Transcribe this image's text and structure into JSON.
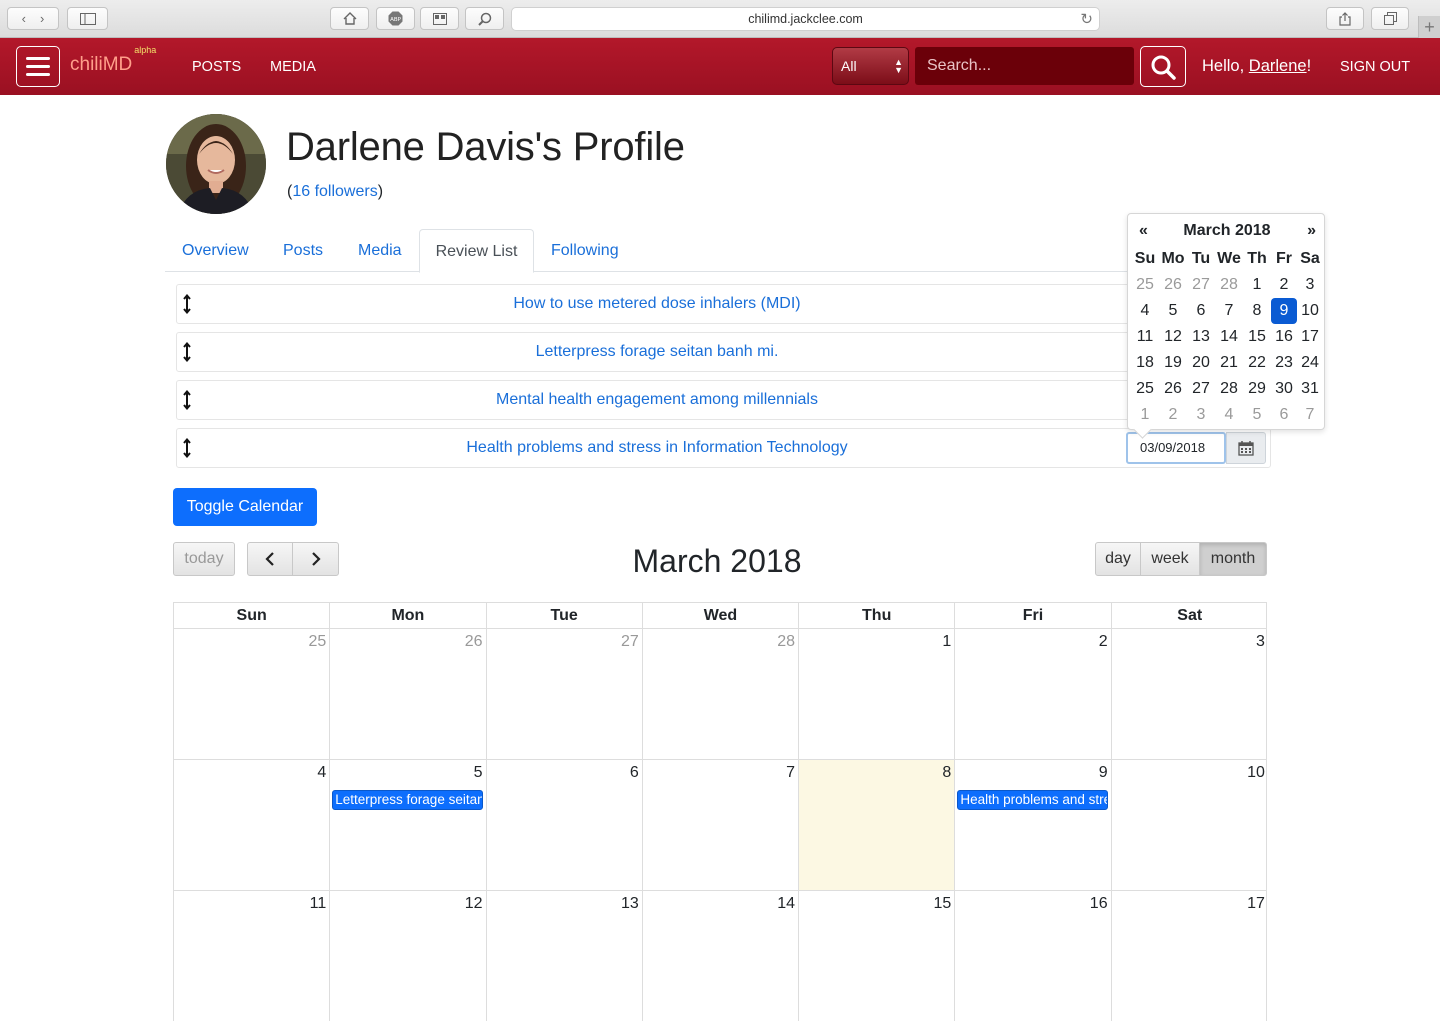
{
  "browser": {
    "url": "chilimd.jackclee.com"
  },
  "nav": {
    "brand": "chiliMD",
    "brand_tag": "alpha",
    "links": [
      "POSTS",
      "MEDIA"
    ],
    "filter_value": "All",
    "search_placeholder": "Search...",
    "hello_prefix": "Hello, ",
    "user_name": "Darlene",
    "hello_suffix": "!",
    "signout": "SIGN OUT",
    "brand_color": "#a8132a"
  },
  "profile": {
    "title": "Darlene Davis's Profile",
    "followers_open": "(",
    "followers_link": "16 followers",
    "followers_close": ")",
    "tabs": [
      "Overview",
      "Posts",
      "Media",
      "Review List",
      "Following"
    ],
    "active_tab": "Review List"
  },
  "review_list": [
    "How to use metered dose inhalers (MDI)",
    "Letterpress forage seitan banh mi.",
    "Mental health engagement among millennials",
    "Health problems and stress in Information Technology"
  ],
  "date_input": "03/09/2018",
  "datepicker": {
    "prev": "«",
    "next": "»",
    "month": "March 2018",
    "dow": [
      "Su",
      "Mo",
      "Tu",
      "We",
      "Th",
      "Fr",
      "Sa"
    ],
    "days": [
      [
        "25",
        "26",
        "27",
        "28",
        "1",
        "2",
        "3"
      ],
      [
        "4",
        "5",
        "6",
        "7",
        "8",
        "9",
        "10"
      ],
      [
        "11",
        "12",
        "13",
        "14",
        "15",
        "16",
        "17"
      ],
      [
        "18",
        "19",
        "20",
        "21",
        "22",
        "23",
        "24"
      ],
      [
        "25",
        "26",
        "27",
        "28",
        "29",
        "30",
        "31"
      ],
      [
        "1",
        "2",
        "3",
        "4",
        "5",
        "6",
        "7"
      ]
    ],
    "selected": "9"
  },
  "toggle_calendar": "Toggle Calendar",
  "calendar": {
    "today_btn": "today",
    "title": "March 2018",
    "views": [
      "day",
      "week",
      "month"
    ],
    "active_view": "month",
    "dow": [
      "Sun",
      "Mon",
      "Tue",
      "Wed",
      "Thu",
      "Fri",
      "Sat"
    ],
    "weeks": [
      [
        "25",
        "26",
        "27",
        "28",
        "1",
        "2",
        "3"
      ],
      [
        "4",
        "5",
        "6",
        "7",
        "8",
        "9",
        "10"
      ],
      [
        "11",
        "12",
        "13",
        "14",
        "15",
        "16",
        "17"
      ]
    ],
    "events": [
      {
        "day": "5",
        "title": "Letterpress forage seitan banh mi."
      },
      {
        "day": "9",
        "title": "Health problems and stress in Information Technology"
      }
    ],
    "today_date": "8"
  }
}
